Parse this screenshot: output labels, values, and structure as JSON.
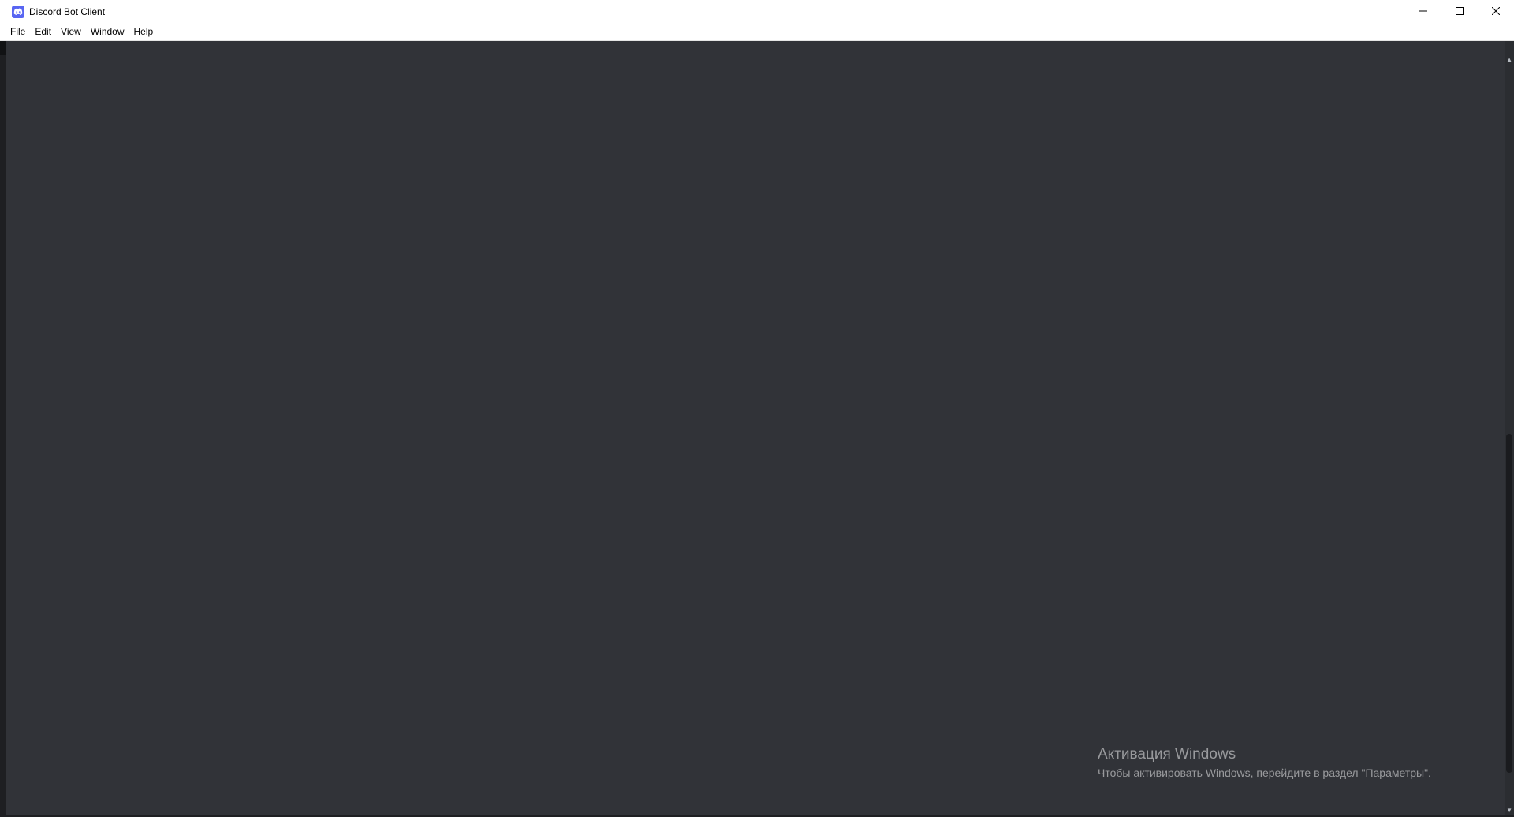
{
  "window": {
    "title": "Discord Bot Client",
    "icon": "discord-icon",
    "controls": {
      "minimize": "minimize-icon",
      "maximize": "maximize-icon",
      "close": "close-icon"
    }
  },
  "menu": {
    "items": [
      {
        "label": "File"
      },
      {
        "label": "Edit"
      },
      {
        "label": "View"
      },
      {
        "label": "Window"
      },
      {
        "label": "Help"
      }
    ]
  },
  "watermark": {
    "title": "Активация Windows",
    "subtitle": "Чтобы активировать Windows, перейдите в раздел \"Параметры\"."
  },
  "colors": {
    "content_background": "#313338",
    "accent": "#5865f2"
  }
}
